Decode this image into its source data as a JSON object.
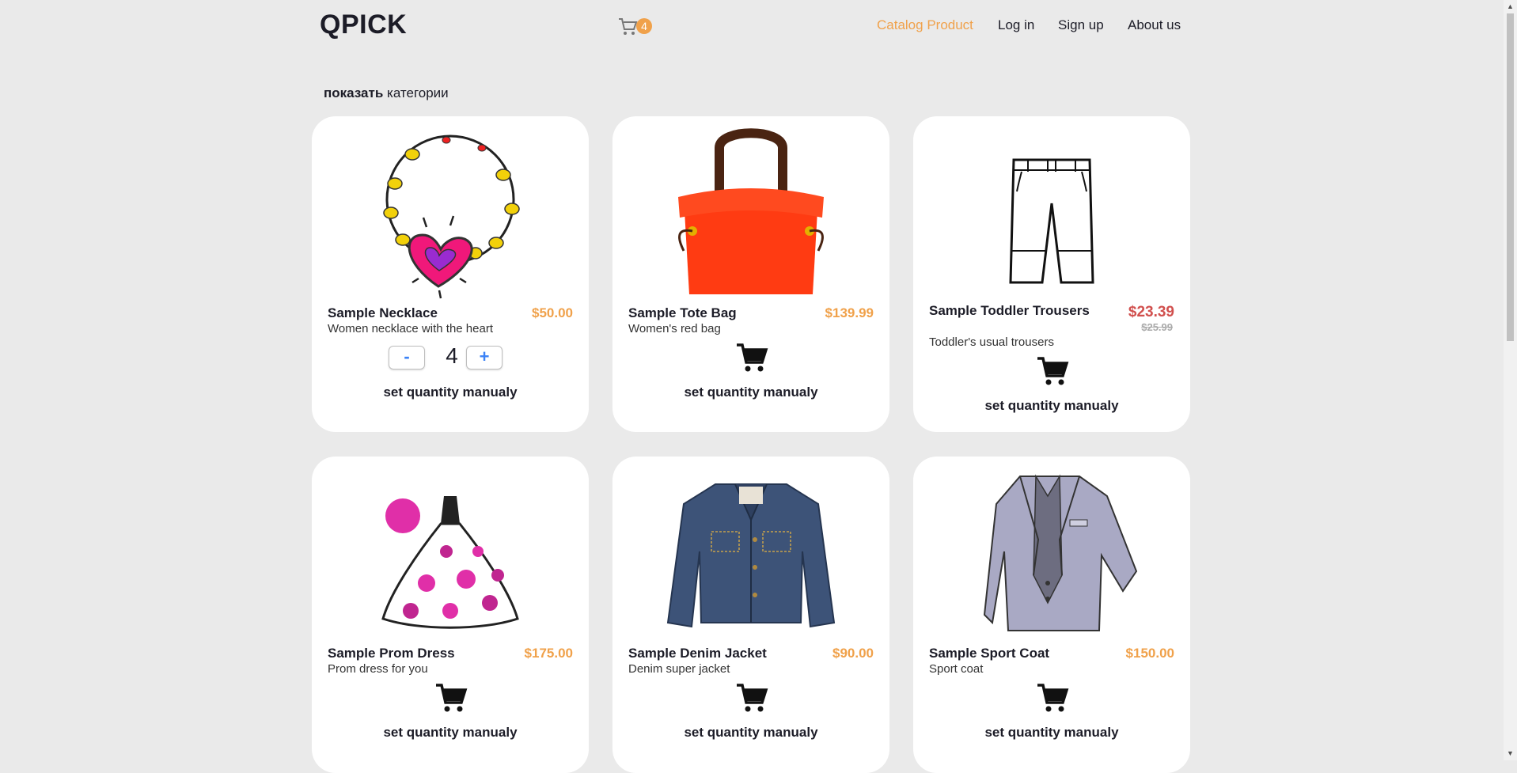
{
  "header": {
    "logo": "QPICK",
    "cart_count": "4",
    "nav": [
      "Catalog Product",
      "Log in",
      "Sign up",
      "About us"
    ]
  },
  "show_categories": {
    "bold": "показать",
    "rest": " категории"
  },
  "set_quantity_label": "set quantity manualy",
  "products": [
    {
      "name": "Sample Necklace",
      "desc": "Women necklace with the heart",
      "price": "$50.00",
      "quantity": "4",
      "minus": "-",
      "plus": "+"
    },
    {
      "name": "Sample Tote Bag",
      "desc": "Women's red bag",
      "price": "$139.99"
    },
    {
      "name": "Sample Toddler Trousers",
      "desc": "Toddler's usual trousers",
      "price": "$23.39",
      "old_price": "$25.99"
    },
    {
      "name": "Sample Prom Dress",
      "desc": "Prom dress for you",
      "price": "$175.00"
    },
    {
      "name": "Sample Denim Jacket",
      "desc": "Denim super jacket",
      "price": "$90.00"
    },
    {
      "name": "Sample Sport Coat",
      "desc": "Sport coat",
      "price": "$150.00"
    }
  ],
  "colors": {
    "accent": "#f0a14a",
    "sale": "#d1504e",
    "bg": "#eaeaea"
  }
}
